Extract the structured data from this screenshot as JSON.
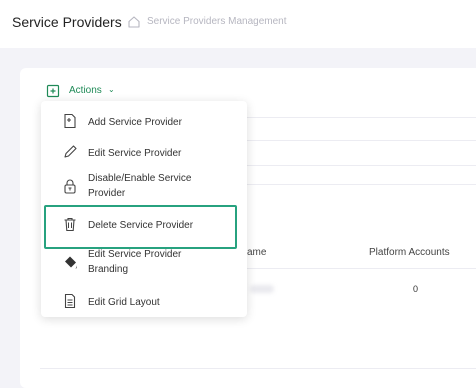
{
  "header": {
    "title": "Service Providers",
    "breadcrumb": "Service Providers Management"
  },
  "toolbar": {
    "actions_label": "Actions"
  },
  "menu": {
    "items": [
      {
        "label": "Add Service Provider",
        "icon": "add-document-icon"
      },
      {
        "label": "Edit Service Provider",
        "icon": "pencil-icon"
      },
      {
        "label": "Disable/Enable Service",
        "label2": "Provider",
        "icon": "lock-toggle-icon"
      },
      {
        "label": "Delete Service Provider",
        "icon": "trash-icon"
      },
      {
        "label": "Edit Service Provider",
        "label2": "Branding",
        "icon": "paint-bucket-icon"
      },
      {
        "label": "Edit Grid Layout",
        "icon": "grid-layout-icon"
      }
    ],
    "highlighted_index": 3
  },
  "table": {
    "columns": [
      "ame",
      "Platform Accounts"
    ],
    "rows": [
      {
        "platform_accounts": "0"
      }
    ]
  },
  "colors": {
    "accent": "#1f8a57",
    "highlight_border": "#27a27f"
  }
}
